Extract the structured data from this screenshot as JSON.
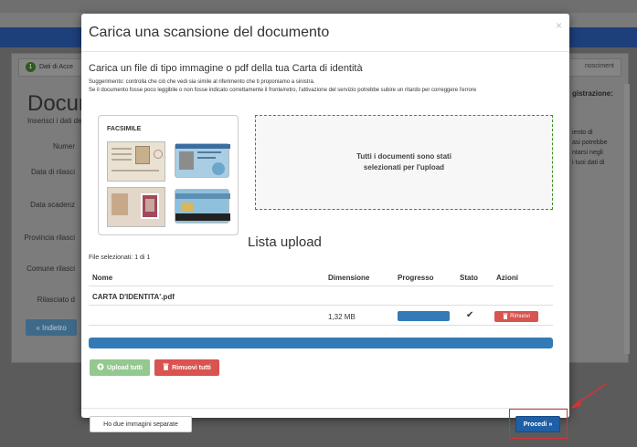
{
  "background": {
    "step1_number": "1",
    "step1_label": "Dati di Acce",
    "step_right": "nosciment",
    "title": "Docum",
    "subtitle": "Inserisci i dati de",
    "labels": [
      "Numer",
      "Data di rilasci",
      "Data scadenz",
      "Provincia rilasci",
      "Comune rilasci",
      "Rilasciato d"
    ],
    "back_button": "« Indietro",
    "right_title": "gistrazione:",
    "right_text": [
      "iento di",
      "asi potrebbe",
      "ntarsi negli",
      "i tuoi dati di"
    ]
  },
  "modal": {
    "title": "Carica una scansione del documento",
    "close_label": "×",
    "intro": "Carica un file di tipo immagine o pdf della tua Carta di identità",
    "hint1": "Suggerimento: controlla che ciò che vedi sia simile al riferimento che ti proponiamo a sinistra.",
    "hint2": "Se il documento fosse poco leggibile o non fosse indicato correttamente il fronte/retro, l'attivazione del servizio potrebbe subire un ritardo per correggere l'errore",
    "sample_label": "FACSIMILE",
    "dropzone_text": "Tutti i documenti sono stati selezionati per l'upload",
    "upload_title": "Lista upload",
    "files_count": "File selezionati: 1 di 1",
    "columns": {
      "name": "Nome",
      "size": "Dimensione",
      "progress": "Progresso",
      "status": "Stato",
      "actions": "Azioni"
    },
    "file": {
      "name": "CARTA D'IDENTITA'.pdf",
      "size": "1,32 MB",
      "progress": 1.0,
      "status_icon": "check-icon",
      "remove_label": "Rimuovi"
    },
    "total_progress": 1.0,
    "upload_all_label": "Upload tutti",
    "remove_all_label": "Rimuovi tutti",
    "separate_images_label": "Ho due immagini separate",
    "proceed_label": "Procedi »",
    "colors": {
      "primary": "#337ab7",
      "danger": "#d9534f",
      "success_disabled": "#93c98e",
      "dropzone_border": "#3c8f1f",
      "annotation": "#d43333"
    }
  }
}
